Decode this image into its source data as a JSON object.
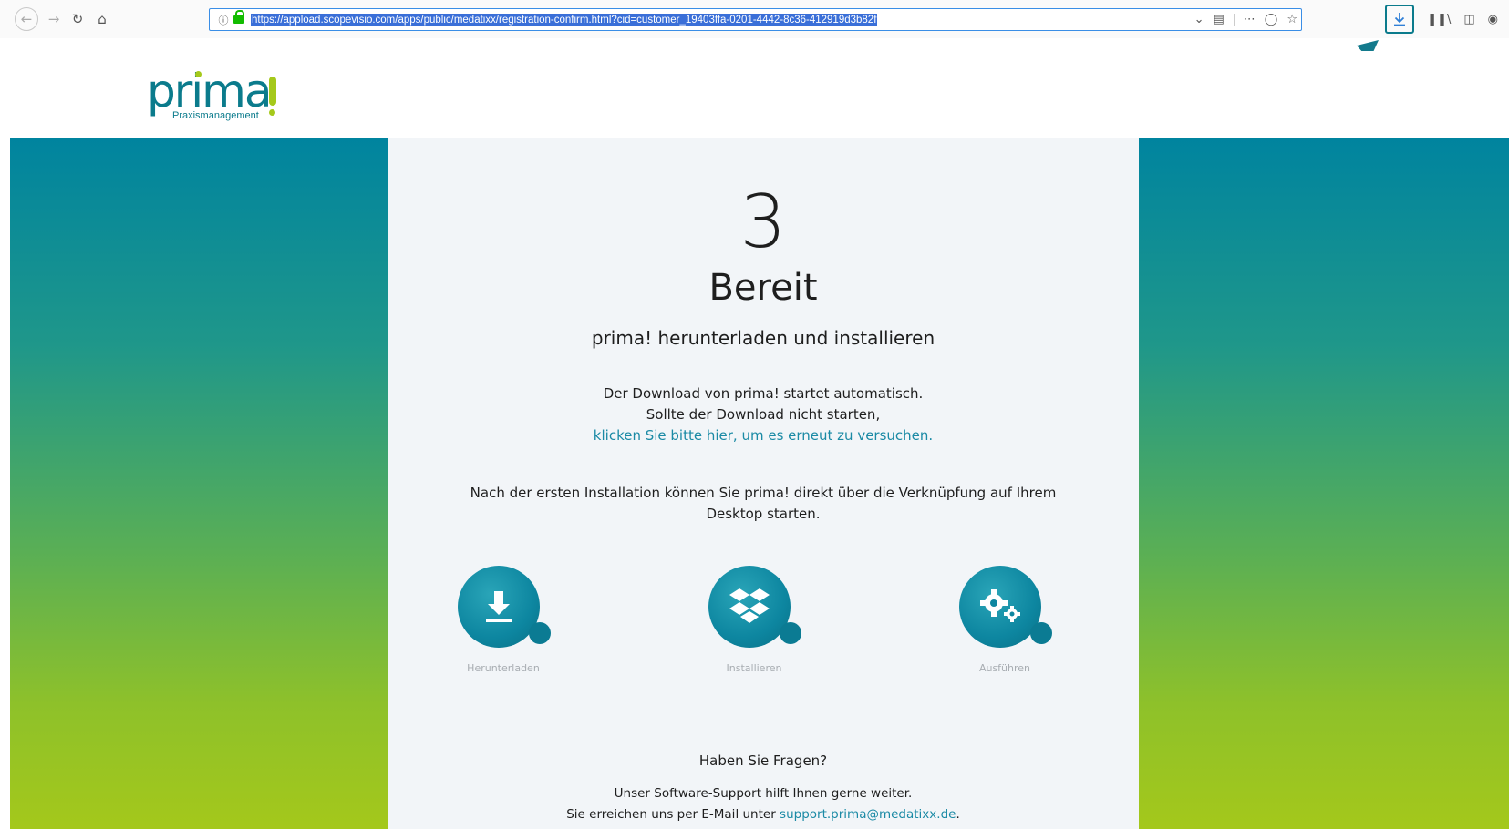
{
  "browser": {
    "url": "https://appload.scopevisio.com/apps/public/medatixx/registration-confirm.html?cid=customer_19403ffa-0201-4442-8c36-412919d3b82f",
    "icons": [
      "back-icon",
      "forward-icon",
      "reload-icon",
      "home-icon",
      "info-icon",
      "lock-icon",
      "dropdown-icon",
      "reader-icon",
      "more-icon",
      "pocket-icon",
      "star-icon",
      "download-icon",
      "library-icon",
      "sidebar-icon",
      "account-icon"
    ]
  },
  "logo": {
    "word": "prima",
    "subtitle": "Praxismanagement"
  },
  "main": {
    "step_number": "3",
    "title": "Bereit",
    "subtitle": "prima! herunterladen und installieren",
    "line1": "Der Download von prima! startet automatisch.",
    "line2": "Sollte der Download nicht starten,",
    "retry_link": "klicken Sie bitte hier, um es erneut zu versuchen.",
    "note": "Nach der ersten Installation können Sie prima! direkt über die Verknüpfung auf Ihrem Desktop starten."
  },
  "steps": [
    {
      "label": "Herunterladen",
      "icon": "download-icon"
    },
    {
      "label": "Installieren",
      "icon": "dropbox-icon"
    },
    {
      "label": "Ausführen",
      "icon": "gears-icon"
    }
  ],
  "support": {
    "question": "Haben Sie Fragen?",
    "line1": "Unser Software-Support hilft Ihnen gerne weiter.",
    "line2_prefix": "Sie erreichen uns per E-Mail unter ",
    "email": "support.prima@medatixx.de",
    "line2_suffix": "."
  },
  "colors": {
    "brand": "#0b7b8c",
    "accent": "#a5c91b",
    "link": "#1b8aa5"
  }
}
